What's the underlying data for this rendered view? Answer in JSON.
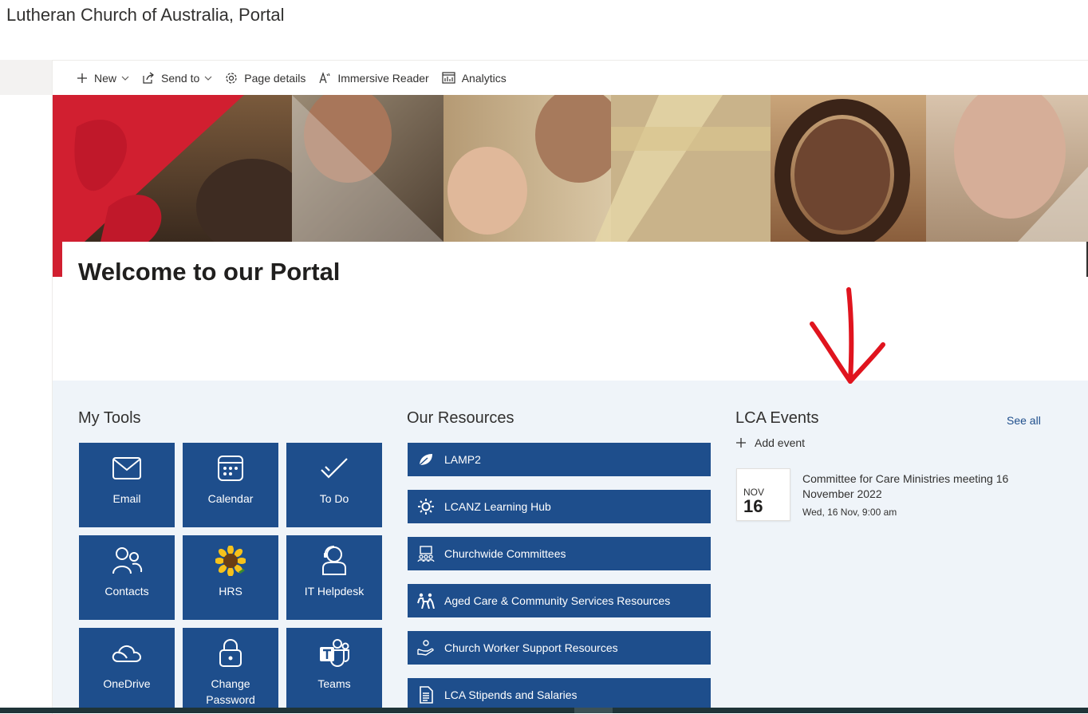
{
  "site": {
    "title": "Lutheran Church of Australia, Portal"
  },
  "commandbar": {
    "new_label": "New",
    "send_to_label": "Send to",
    "page_details_label": "Page details",
    "immersive_reader_label": "Immersive Reader",
    "analytics_label": "Analytics"
  },
  "page": {
    "heading": "Welcome to our Portal"
  },
  "my_tools": {
    "heading": "My Tools",
    "tiles": [
      {
        "label": "Email",
        "icon": "mail-icon"
      },
      {
        "label": "Calendar",
        "icon": "calendar-icon"
      },
      {
        "label": "To Do",
        "icon": "todo-check-icon"
      },
      {
        "label": "Contacts",
        "icon": "contacts-icon"
      },
      {
        "label": "HRS",
        "icon": "sunflower-icon"
      },
      {
        "label": "IT Helpdesk",
        "icon": "helpdesk-person-icon"
      },
      {
        "label": "OneDrive",
        "icon": "onedrive-cloud-icon"
      },
      {
        "label": "Change\nPassword",
        "icon": "lock-icon"
      },
      {
        "label": "Teams",
        "icon": "teams-icon"
      }
    ]
  },
  "our_resources": {
    "heading": "Our Resources",
    "items": [
      {
        "label": "LAMP2",
        "icon": "leaf-icon"
      },
      {
        "label": "LCANZ Learning Hub",
        "icon": "sun-gear-icon"
      },
      {
        "label": "Churchwide Committees",
        "icon": "committee-icon"
      },
      {
        "label": "Aged Care & Community Services Resources",
        "icon": "family-icon"
      },
      {
        "label": "Church Worker Support Resources",
        "icon": "support-hands-icon"
      },
      {
        "label": "LCA Stipends and Salaries",
        "icon": "document-icon"
      }
    ]
  },
  "events": {
    "heading": "LCA Events",
    "see_all_label": "See all",
    "add_event_label": "Add event",
    "items": [
      {
        "month": "NOV",
        "day": "16",
        "title": "Committee for Care Ministries meeting 16 November 2022",
        "when": "Wed, 16 Nov, 9:00 am"
      }
    ]
  },
  "colors": {
    "tile_blue": "#1e4e8c",
    "brand_red": "#d11f30",
    "annotation_red": "#e0141e",
    "section_bg": "#eff4f9"
  }
}
